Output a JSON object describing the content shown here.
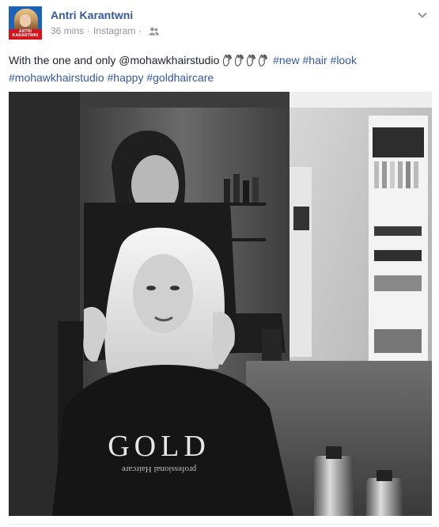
{
  "post": {
    "author": "Antri Karantwni",
    "time": "36 mins",
    "source": "Instagram",
    "caption_text": "With the one and only @mohawkhairstudio",
    "hashtags_line1": [
      "#new",
      "#hair",
      "#look"
    ],
    "hashtags_line2": [
      "#mohawkhairstudio",
      "#happy",
      "#goldhaircare"
    ],
    "photo_shirt_text": "GOLD",
    "photo_shirt_subtext": "professional Haircare",
    "avatar_text": "ANTRI KARANTWNI"
  },
  "icons": {
    "privacy": "friends-icon",
    "menu": "chevron-down-icon",
    "emoji": "clapping-hands-icon"
  },
  "colors": {
    "link": "#365899",
    "meta": "#90949c",
    "text": "#1d2129",
    "avatar_bg": "#1d63b5",
    "avatar_band": "#d3151d"
  }
}
